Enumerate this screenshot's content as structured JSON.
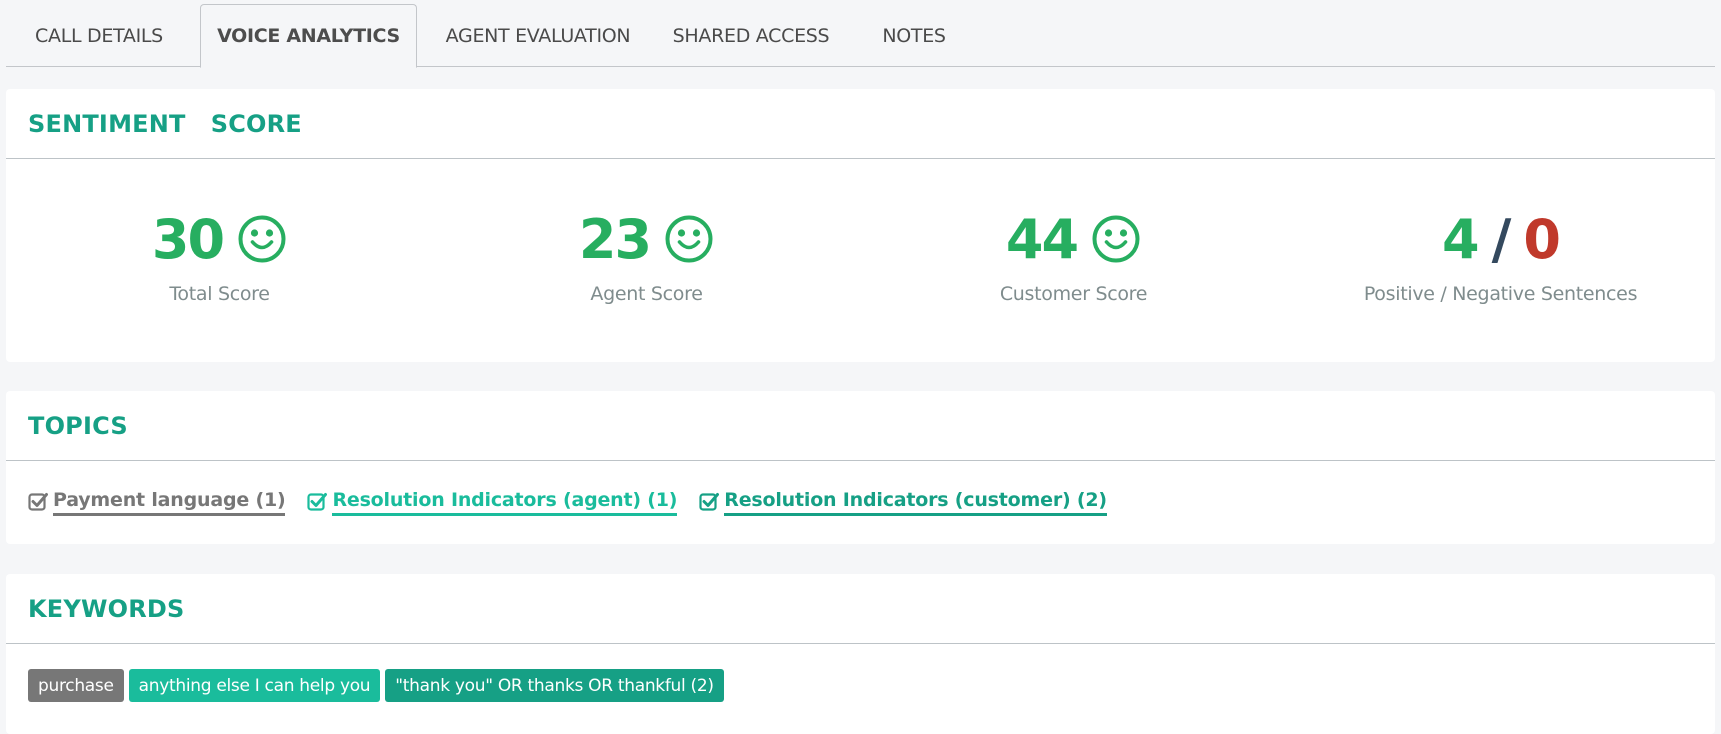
{
  "tabs": [
    {
      "label": "CALL DETAILS",
      "active": false
    },
    {
      "label": "VOICE ANALYTICS",
      "active": true
    },
    {
      "label": "AGENT EVALUATION",
      "active": false
    },
    {
      "label": "SHARED ACCESS",
      "active": false
    },
    {
      "label": "NOTES",
      "active": false
    }
  ],
  "sentiment": {
    "title": "SENTIMENT  SCORE",
    "scores": [
      {
        "value": "30",
        "label": "Total Score",
        "icon": "smile-icon"
      },
      {
        "value": "23",
        "label": "Agent Score",
        "icon": "smile-icon"
      },
      {
        "value": "44",
        "label": "Customer Score",
        "icon": "smile-icon"
      }
    ],
    "sentences": {
      "positive": "4",
      "separator": "/",
      "negative": "0",
      "label": "Positive / Negative Sentences"
    }
  },
  "topics": {
    "title": "TOPICS",
    "items": [
      {
        "label": "Payment language (1)",
        "checked": true,
        "color": "#777777"
      },
      {
        "label": "Resolution Indicators (agent) (1)",
        "checked": true,
        "color": "#1abc9c"
      },
      {
        "label": "Resolution Indicators (customer) (2)",
        "checked": true,
        "color": "#16a085"
      }
    ]
  },
  "keywords": {
    "title": "KEYWORDS",
    "items": [
      {
        "label": "purchase",
        "color": "#777777"
      },
      {
        "label": "anything else I can help you",
        "color": "#1abc9c"
      },
      {
        "label": "\"thank you\" OR thanks OR thankful (2)",
        "color": "#16a085"
      }
    ]
  },
  "colors": {
    "heading": "#16a085",
    "positive": "#27ae60",
    "negative": "#c0392b",
    "separator": "#34495e",
    "muted_text": "#7f8c8d",
    "background": "#f5f6f8"
  }
}
